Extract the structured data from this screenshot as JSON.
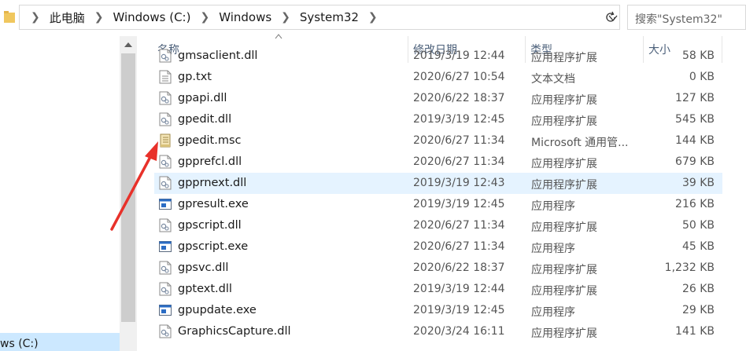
{
  "address": {
    "crumbs": [
      "此电脑",
      "Windows (C:)",
      "Windows",
      "System32"
    ],
    "search_placeholder": "搜索\"System32\""
  },
  "nav": {
    "drive_label": "ws (C:)"
  },
  "columns": {
    "name": "名称",
    "date": "修改日期",
    "type": "类型",
    "size": "大小"
  },
  "files": [
    {
      "name": "gmsaclient.dll",
      "date": "2019/3/19 12:44",
      "type": "应用程序扩展",
      "size": "58 KB",
      "icon": "dll-icon"
    },
    {
      "name": "gp.txt",
      "date": "2020/6/27 10:54",
      "type": "文本文档",
      "size": "0 KB",
      "icon": "text-file-icon"
    },
    {
      "name": "gpapi.dll",
      "date": "2020/6/22 18:37",
      "type": "应用程序扩展",
      "size": "127 KB",
      "icon": "dll-icon"
    },
    {
      "name": "gpedit.dll",
      "date": "2019/3/19 12:45",
      "type": "应用程序扩展",
      "size": "545 KB",
      "icon": "dll-icon"
    },
    {
      "name": "gpedit.msc",
      "date": "2020/6/27 11:34",
      "type": "Microsoft 通用管...",
      "size": "144 KB",
      "icon": "msc-icon"
    },
    {
      "name": "gpprefcl.dll",
      "date": "2020/6/27 11:34",
      "type": "应用程序扩展",
      "size": "679 KB",
      "icon": "dll-icon"
    },
    {
      "name": "gpprnext.dll",
      "date": "2019/3/19 12:43",
      "type": "应用程序扩展",
      "size": "39 KB",
      "icon": "dll-icon",
      "selected": true
    },
    {
      "name": "gpresult.exe",
      "date": "2019/3/19 12:45",
      "type": "应用程序",
      "size": "216 KB",
      "icon": "exe-icon"
    },
    {
      "name": "gpscript.dll",
      "date": "2020/6/27 11:34",
      "type": "应用程序扩展",
      "size": "50 KB",
      "icon": "dll-icon"
    },
    {
      "name": "gpscript.exe",
      "date": "2020/6/27 11:34",
      "type": "应用程序",
      "size": "45 KB",
      "icon": "exe-icon"
    },
    {
      "name": "gpsvc.dll",
      "date": "2020/6/22 18:37",
      "type": "应用程序扩展",
      "size": "1,232 KB",
      "icon": "dll-icon"
    },
    {
      "name": "gptext.dll",
      "date": "2019/3/19 12:44",
      "type": "应用程序扩展",
      "size": "26 KB",
      "icon": "dll-icon"
    },
    {
      "name": "gpupdate.exe",
      "date": "2019/3/19 12:45",
      "type": "应用程序",
      "size": "29 KB",
      "icon": "exe-icon"
    },
    {
      "name": "GraphicsCapture.dll",
      "date": "2020/3/24 16:11",
      "type": "应用程序扩展",
      "size": "141 KB",
      "icon": "dll-icon"
    }
  ],
  "colors": {
    "selected_row": "#e5f3ff",
    "annotation_arrow": "#e8312a",
    "header_text": "#4c607a"
  }
}
